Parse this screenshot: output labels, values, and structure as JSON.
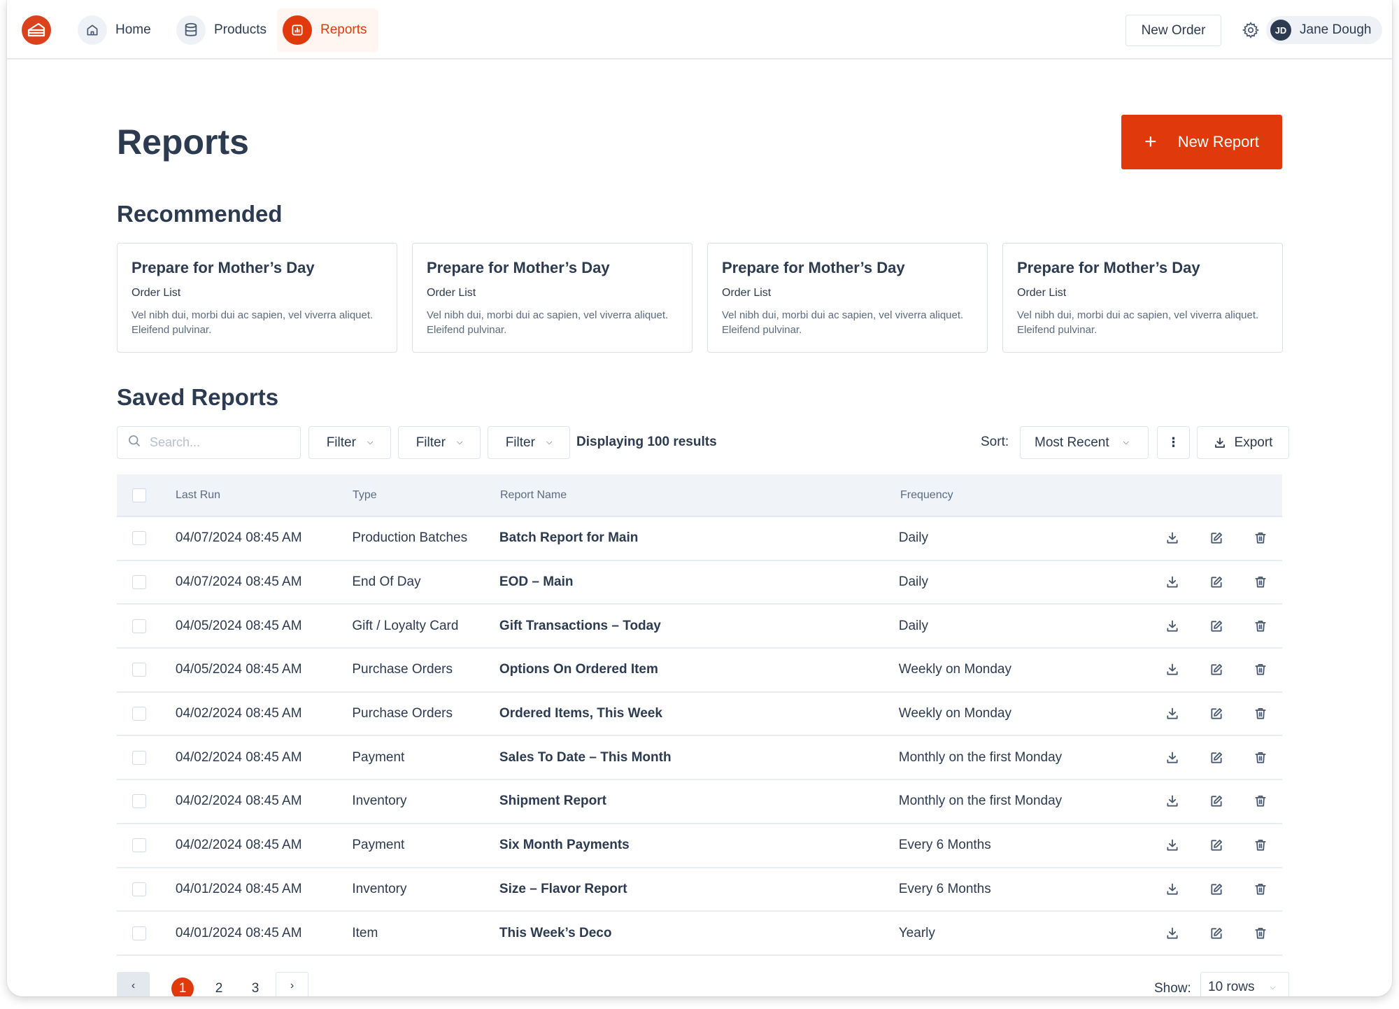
{
  "nav": {
    "logo": "cake-slice-logo",
    "items": [
      {
        "label": "Home",
        "icon": "home-icon",
        "active": false
      },
      {
        "label": "Products",
        "icon": "database-icon",
        "active": false
      },
      {
        "label": "Reports",
        "icon": "bar-chart-icon",
        "active": true
      }
    ],
    "new_order_label": "New Order",
    "settings_icon": "gear-icon",
    "user": {
      "initials": "JD",
      "name": "Jane Dough"
    }
  },
  "colors": {
    "accent": "#e03a0c",
    "text": "#2d3b50",
    "muted": "#5b6b80",
    "header_bg": "#f0f3f8",
    "border": "#dfe5ec"
  },
  "page": {
    "title": "Reports",
    "new_report_label": "New Report",
    "recommended_title": "Recommended",
    "saved_title": "Saved Reports"
  },
  "recommended": [
    {
      "title": "Prepare for Mother’s Day",
      "subtitle": "Order List",
      "description": "Vel nibh dui, morbi dui ac sapien, vel viverra aliquet. Eleifend pulvinar."
    },
    {
      "title": "Prepare for Mother’s Day",
      "subtitle": "Order List",
      "description": "Vel nibh dui, morbi dui ac sapien, vel viverra aliquet. Eleifend pulvinar."
    },
    {
      "title": "Prepare for Mother’s Day",
      "subtitle": "Order List",
      "description": "Vel nibh dui, morbi dui ac sapien, vel viverra aliquet. Eleifend pulvinar."
    },
    {
      "title": "Prepare for Mother’s Day",
      "subtitle": "Order List",
      "description": "Vel nibh dui, morbi dui ac sapien, vel viverra aliquet. Eleifend pulvinar."
    }
  ],
  "toolbar": {
    "search_placeholder": "Search...",
    "search_value": "",
    "filters": [
      "Filter",
      "Filter",
      "Filter"
    ],
    "results_text": "Displaying 100 results",
    "sort_label": "Sort:",
    "sort_value": "Most Recent",
    "more_icon": "kebab-icon",
    "export_label": "Export"
  },
  "table": {
    "columns": [
      "Last Run",
      "Type",
      "Report Name",
      "Frequency"
    ],
    "rows": [
      {
        "last_run": "04/07/2024 08:45 AM",
        "type": "Production Batches",
        "name": "Batch Report for Main",
        "frequency": "Daily"
      },
      {
        "last_run": "04/07/2024 08:45 AM",
        "type": "End Of Day",
        "name": "EOD – Main",
        "frequency": "Daily"
      },
      {
        "last_run": "04/05/2024 08:45 AM",
        "type": "Gift / Loyalty Card",
        "name": "Gift Transactions – Today",
        "frequency": "Daily"
      },
      {
        "last_run": "04/05/2024 08:45 AM",
        "type": "Purchase Orders",
        "name": "Options On Ordered Item",
        "frequency": "Weekly on Monday"
      },
      {
        "last_run": "04/02/2024 08:45 AM",
        "type": "Purchase Orders",
        "name": "Ordered Items, This Week",
        "frequency": "Weekly on Monday"
      },
      {
        "last_run": "04/02/2024 08:45 AM",
        "type": "Payment",
        "name": "Sales To Date – This Month",
        "frequency": "Monthly on the first Monday"
      },
      {
        "last_run": "04/02/2024 08:45 AM",
        "type": "Inventory",
        "name": "Shipment Report",
        "frequency": "Monthly on the first Monday"
      },
      {
        "last_run": "04/02/2024 08:45 AM",
        "type": "Payment",
        "name": "Six Month Payments",
        "frequency": "Every 6 Months"
      },
      {
        "last_run": "04/01/2024 08:45 AM",
        "type": "Inventory",
        "name": "Size – Flavor Report",
        "frequency": "Every 6 Months"
      },
      {
        "last_run": "04/01/2024 08:45 AM",
        "type": "Item",
        "name": "This Week’s Deco",
        "frequency": "Yearly"
      }
    ]
  },
  "pagination": {
    "pages": [
      "1",
      "2",
      "3"
    ],
    "current": "1",
    "show_label": "Show:",
    "rows_value": "10 rows"
  }
}
